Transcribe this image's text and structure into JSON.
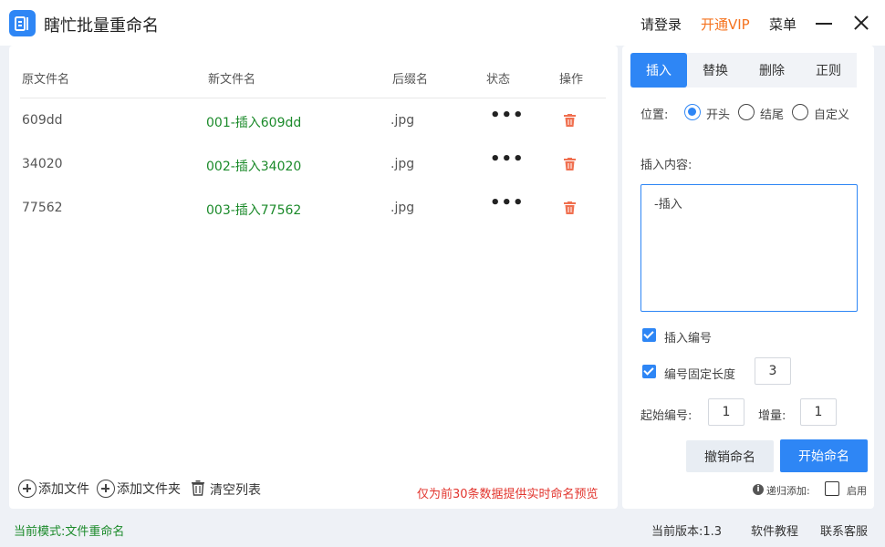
{
  "app": {
    "title": "瞎忙批量重命名"
  },
  "header": {
    "login": "请登录",
    "vip": "开通VIP",
    "menu": "菜单"
  },
  "table": {
    "columns": [
      "原文件名",
      "新文件名",
      "后缀名",
      "状态",
      "操作"
    ],
    "rows": [
      {
        "original": "609dd",
        "new_name": "001-插入609dd",
        "ext": ".jpg",
        "status": "•••"
      },
      {
        "original": "34020",
        "new_name": "002-插入34020",
        "ext": ".jpg",
        "status": "•••"
      },
      {
        "original": "77562",
        "new_name": "003-插入77562",
        "ext": ".jpg",
        "status": "•••"
      }
    ]
  },
  "toolbar": {
    "add_file": "添加文件",
    "add_folder": "添加文件夹",
    "clear_list": "清空列表",
    "preview_note": "仅为前30条数据提供实时命名预览"
  },
  "right": {
    "tabs": [
      "插入",
      "替换",
      "删除",
      "正则"
    ],
    "active_tab": "插入",
    "position_label": "位置:",
    "position_options": [
      "开头",
      "结尾",
      "自定义"
    ],
    "position_selected": "开头",
    "insert_content_label": "插入内容:",
    "insert_content": "-插入",
    "insert_number_label": "插入编号",
    "insert_number_checked": true,
    "fixed_length_label": "编号固定长度",
    "fixed_length_checked": true,
    "fixed_length_value": "3",
    "start_label": "起始编号:",
    "start_value": "1",
    "increment_label": "增量:",
    "increment_value": "1",
    "undo_button": "撤销命名",
    "start_button": "开始命名",
    "recursive_label": "递归添加:",
    "enable_label": "启用",
    "recursive_enabled": false
  },
  "footer": {
    "mode": "当前模式:文件重命名",
    "version": "当前版本:1.3",
    "tutorial": "软件教程",
    "support": "联系客服"
  },
  "colors": {
    "accent": "#2e86f5",
    "vip": "#f5731f",
    "new_name": "#1b8a2a",
    "warning": "#e2352e",
    "delete": "#f07050"
  }
}
